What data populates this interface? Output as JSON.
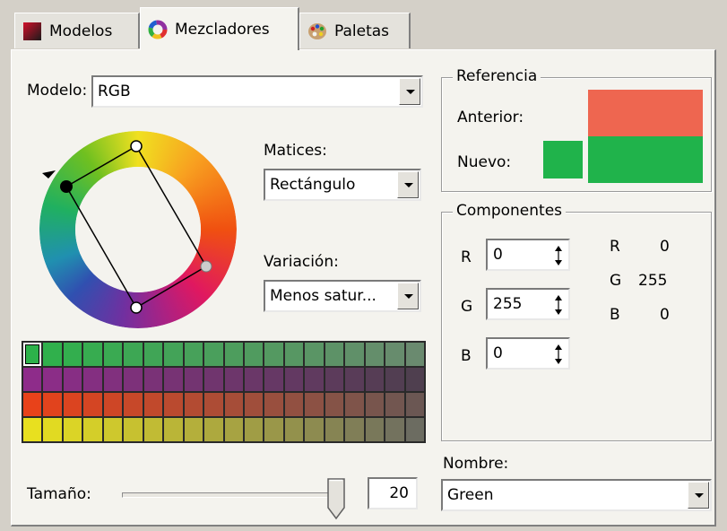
{
  "tabs": [
    {
      "label": "Modelos",
      "icon": "color-model-icon"
    },
    {
      "label": "Mezcladores",
      "icon": "color-wheel-icon"
    },
    {
      "label": "Paletas",
      "icon": "palette-icon"
    }
  ],
  "model": {
    "label": "Modelo:",
    "value": "RGB"
  },
  "harmonies": {
    "label": "Matices:",
    "value": "Rectángulo"
  },
  "variation": {
    "label": "Variación:",
    "value": "Menos satur..."
  },
  "reference": {
    "title": "Referencia",
    "previous_label": "Anterior:",
    "new_label": "Nuevo:",
    "previous_color": "#ee6650",
    "new_color": "#20b34b"
  },
  "components": {
    "title": "Componentes",
    "r": {
      "label": "R",
      "value": "0"
    },
    "g": {
      "label": "G",
      "value": "255"
    },
    "b": {
      "label": "B",
      "value": "0"
    },
    "readout": [
      {
        "label": "R",
        "value": "0"
      },
      {
        "label": "G",
        "value": "255"
      },
      {
        "label": "B",
        "value": "0"
      }
    ]
  },
  "size": {
    "label": "Tamaño:",
    "value": "20"
  },
  "name": {
    "label": "Nombre:",
    "value": "Green"
  },
  "swatches": {
    "rows": [
      {
        "from": "#2db24a",
        "to": "#6a8a6f"
      },
      {
        "from": "#8e2c8a",
        "to": "#4f3f4f"
      },
      {
        "from": "#e8421a",
        "to": "#6b5753"
      },
      {
        "from": "#e8e01f",
        "to": "#6c6c61"
      }
    ],
    "columns": 20
  }
}
